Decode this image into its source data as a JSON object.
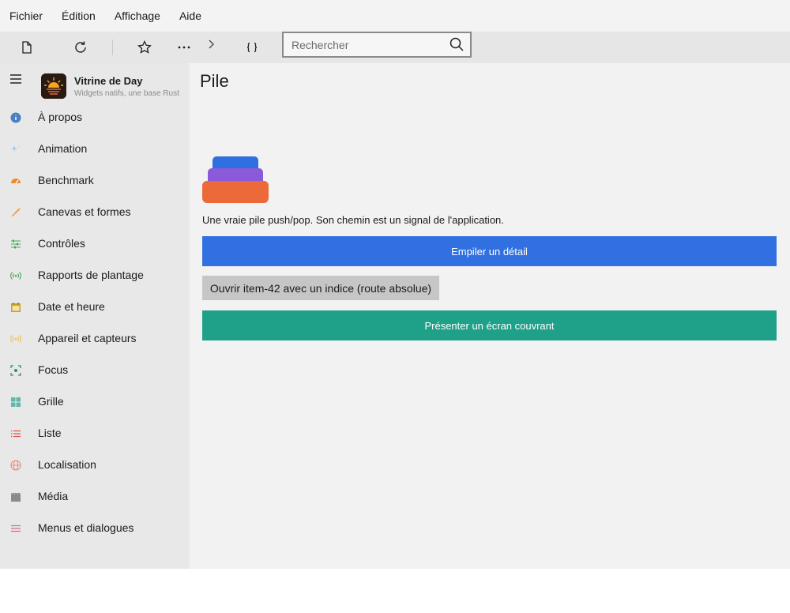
{
  "menu": [
    "Fichier",
    "Édition",
    "Affichage",
    "Aide"
  ],
  "toolbar": {
    "search_placeholder": "Rechercher",
    "icons": [
      "new-document-icon",
      "refresh-icon",
      "star-icon",
      "more-icon",
      "chevron-right-icon",
      "braces-icon",
      "search-icon"
    ]
  },
  "app": {
    "title": "Vitrine de Day",
    "subtitle": "Widgets natifs, une base Rust"
  },
  "sidebar": {
    "items": [
      {
        "label": "À propos",
        "icon": "info-icon",
        "color": "#4a7fc1"
      },
      {
        "label": "Animation",
        "icon": "sparkle-icon",
        "color": "#a9c7ea"
      },
      {
        "label": "Benchmark",
        "icon": "gauge-icon",
        "color": "#f08a24"
      },
      {
        "label": "Canevas et formes",
        "icon": "brush-icon",
        "color": "#f0a24a"
      },
      {
        "label": "Contrôles",
        "icon": "sliders-icon",
        "color": "#4aa85a"
      },
      {
        "label": "Rapports de plantage",
        "icon": "broadcast-icon",
        "color": "#4aa85a"
      },
      {
        "label": "Date et heure",
        "icon": "calendar-icon",
        "color": "#c9a227"
      },
      {
        "label": "Appareil et capteurs",
        "icon": "sensor-icon",
        "color": "#f0c24a"
      },
      {
        "label": "Focus",
        "icon": "focus-icon",
        "color": "#2f8f7a"
      },
      {
        "label": "Grille",
        "icon": "grid-icon",
        "color": "#5fb8a8"
      },
      {
        "label": "Liste",
        "icon": "list-icon",
        "color": "#e0504a"
      },
      {
        "label": "Localisation",
        "icon": "globe-icon",
        "color": "#ec8a7a"
      },
      {
        "label": "Média",
        "icon": "clapper-icon",
        "color": "#8a8a8a"
      },
      {
        "label": "Menus et dialogues",
        "icon": "menu-lines-icon",
        "color": "#e06a7a"
      }
    ]
  },
  "main": {
    "title": "Pile",
    "description": "Une vraie pile push/pop. Son chemin est un signal de l'application.",
    "push_button": "Empiler un détail",
    "open_button": "Ouvrir item-42 avec un indice (route absolue)",
    "present_button": "Présenter un écran couvrant"
  },
  "colors": {
    "primary": "#3070e0",
    "teal": "#1fa088",
    "stack_top": "#2f6fe0",
    "stack_mid": "#8a5ad8",
    "stack_bottom": "#ec6a3a"
  }
}
